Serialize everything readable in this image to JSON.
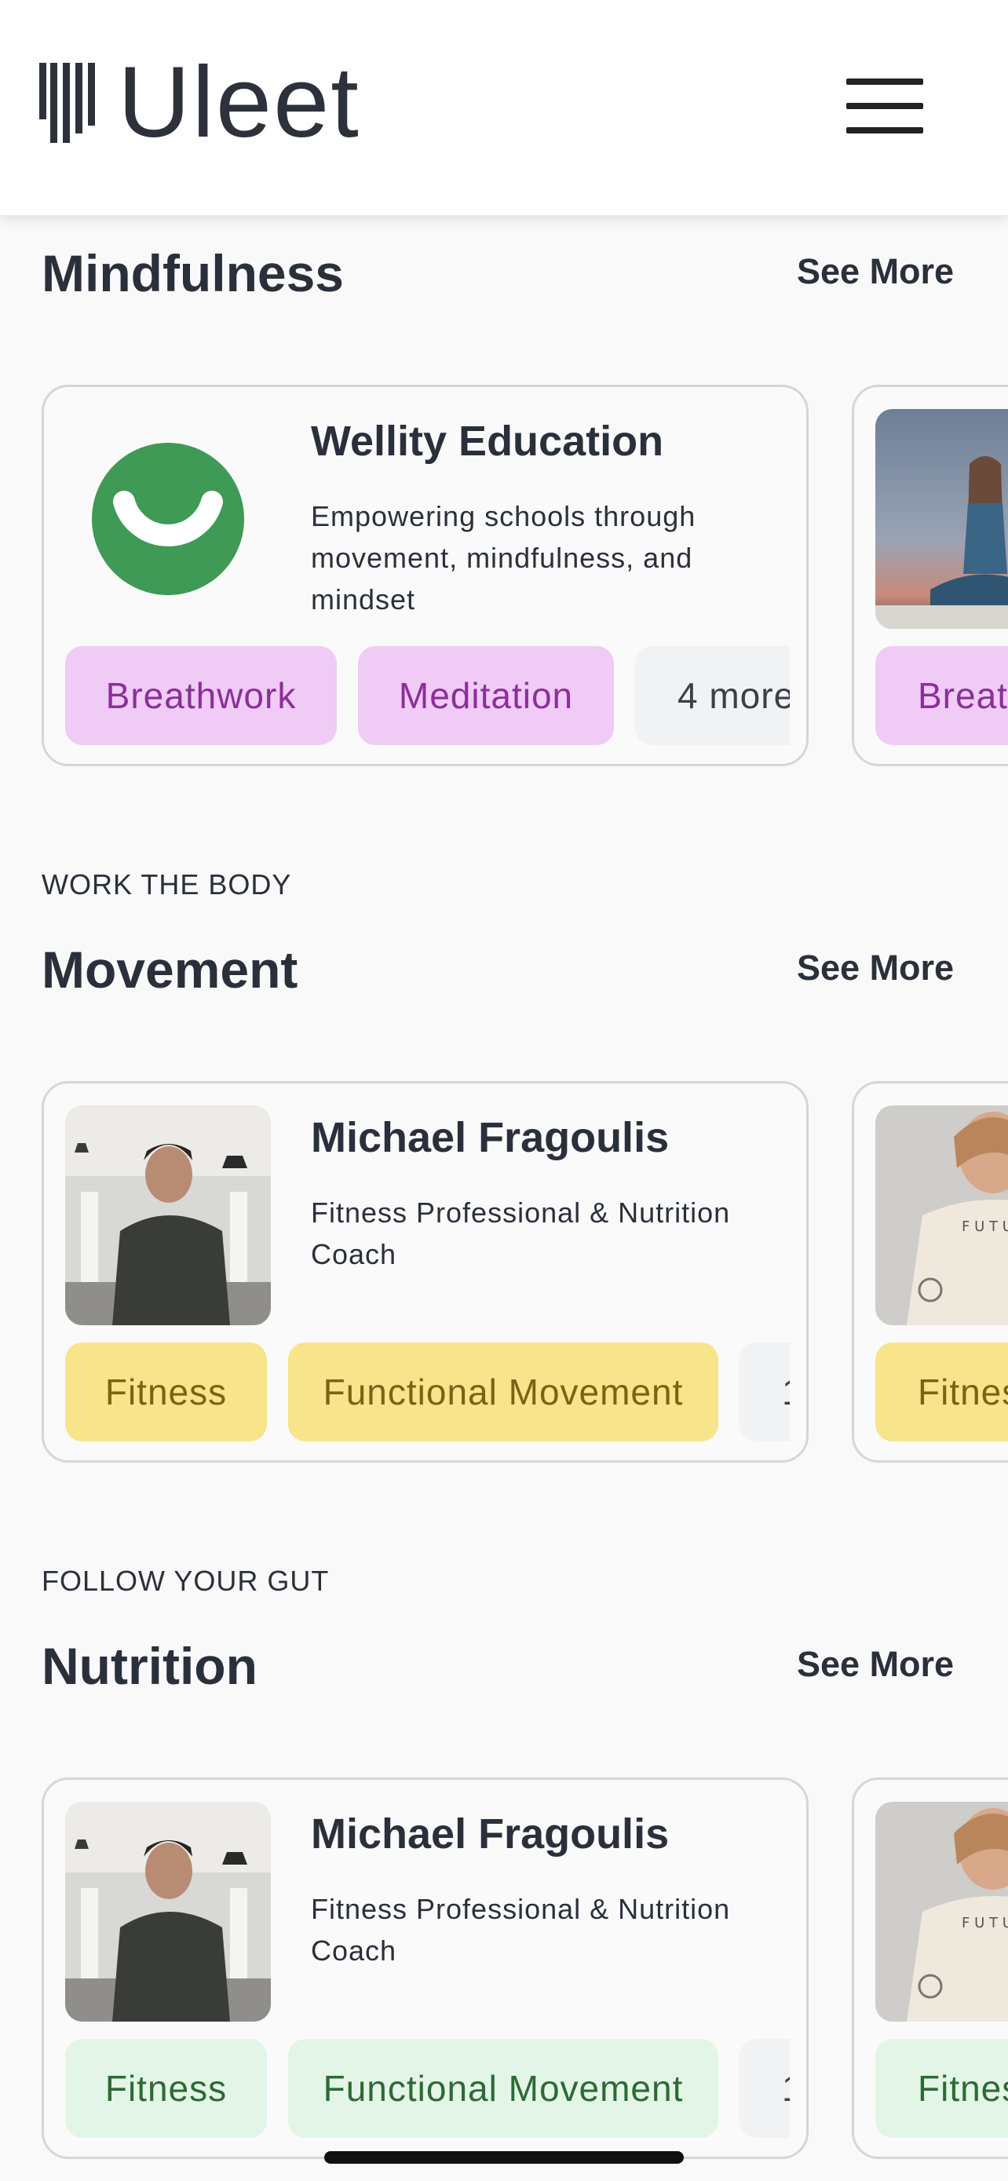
{
  "app": {
    "logo_text": "Uleet"
  },
  "header": {
    "menu_icon": "hamburger-menu-icon",
    "logo_icon": "uleet-bars-icon"
  },
  "colors": {
    "text": "#2a303b",
    "tag_purple_bg": "#f0cbf5",
    "tag_purple_fg": "#8a2f99",
    "tag_yellow_bg": "#f8e48b",
    "tag_yellow_fg": "#7d6215",
    "tag_green_bg": "#e3f5e6",
    "tag_green_fg": "#2d6a35",
    "tag_gray_bg": "#f1f2f4",
    "logo_green": "#3f9a55"
  },
  "sections": [
    {
      "subtitle": "",
      "title": "Mindfulness",
      "see_more": "See More",
      "card": {
        "name": "Wellity Education",
        "description": "Empowering schools through movement, mindfulness, and mindset",
        "image": "wellity-smile-logo",
        "tags": [
          "Breathwork",
          "Meditation",
          "4 more"
        ]
      },
      "peek_card": {
        "image": "woman-meditating-photo",
        "tags": [
          "Breat"
        ]
      }
    },
    {
      "subtitle": "WORK THE BODY",
      "title": "Movement",
      "see_more": "See More",
      "card": {
        "name": "Michael Fragoulis",
        "description": "Fitness Professional & Nutrition Coach",
        "image": "man-gym-portrait-photo",
        "tags": [
          "Fitness",
          "Functional Movement",
          "1"
        ]
      },
      "peek_card": {
        "image": "woman-sweater-portrait-photo",
        "tags": [
          "Fitnes"
        ]
      }
    },
    {
      "subtitle": "FOLLOW YOUR GUT",
      "title": "Nutrition",
      "see_more": "See More",
      "card": {
        "name": "Michael Fragoulis",
        "description": "Fitness Professional & Nutrition Coach",
        "image": "man-gym-portrait-photo",
        "tags": [
          "Fitness",
          "Functional Movement",
          "1"
        ]
      },
      "peek_card": {
        "image": "woman-sweater-portrait-photo",
        "tags": [
          "Fitnes"
        ]
      }
    }
  ]
}
